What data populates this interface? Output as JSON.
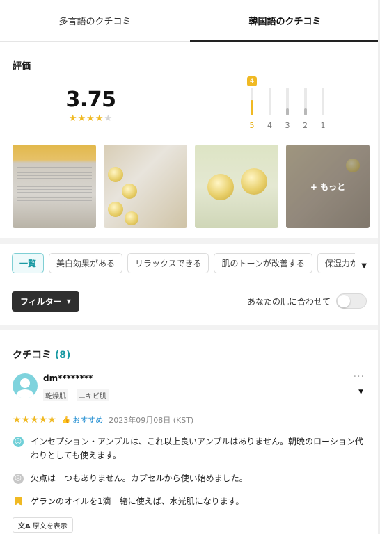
{
  "tabs": [
    {
      "label": "多言語のクチコミ",
      "active": false
    },
    {
      "label": "韓国語のクチコミ",
      "active": true
    }
  ],
  "rating": {
    "title": "評価",
    "score": "3.75",
    "stars_filled": 3.75,
    "distribution": {
      "labels": [
        "5",
        "4",
        "3",
        "2",
        "1"
      ],
      "levels": [
        0.55,
        0,
        0.25,
        0.25,
        0
      ],
      "badge": "4",
      "highlight_color": "#f0b923"
    }
  },
  "photos": {
    "more_label": "+ もっと"
  },
  "chips": [
    {
      "label": "一覧",
      "active": true
    },
    {
      "label": "美白効果がある",
      "active": false
    },
    {
      "label": "リラックスできる",
      "active": false
    },
    {
      "label": "肌のトーンが改善する",
      "active": false
    },
    {
      "label": "保湿力が高",
      "active": false
    }
  ],
  "filter": {
    "button_label": "フィルター",
    "toggle_label": "あなたの肌に合わせて",
    "toggle_on": false
  },
  "reviews": {
    "title": "クチコミ",
    "count": "(8)",
    "items": [
      {
        "user": "dm********",
        "skin_tags": [
          "乾燥肌",
          "ニキビ肌"
        ],
        "stars": 5,
        "recommend": "おすすめ",
        "date": "2023年09月08日 (KST)",
        "good": "インセプション・アンプルは、これ以上良いアンプルはありません。朝晩のローション代わりとしても使えます。",
        "bad": "欠点は一つもありません。カプセルから使い始めました。",
        "tip": "ゲランのオイルを1滴一緒に使えば、水光肌になります。",
        "translate_label": "原文を表示"
      }
    ]
  },
  "colors": {
    "accent": "#1a9aa3",
    "star": "#f0b923",
    "link": "#1a8ad0"
  }
}
